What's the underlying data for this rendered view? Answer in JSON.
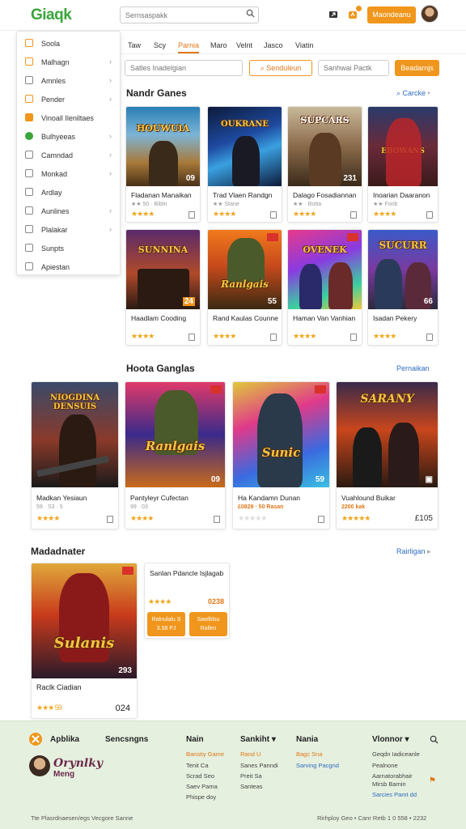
{
  "header": {
    "logo": "Giaqk",
    "search_placeholder": "Sernsaspakk",
    "primary_button": "Maondeanu"
  },
  "sidebar": {
    "items": [
      {
        "label": "Soola",
        "icon": "square-outline-icon",
        "color": "#f0961c",
        "chevron": false
      },
      {
        "label": "Malhagn",
        "icon": "edit-icon",
        "color": "#f0961c",
        "chevron": true
      },
      {
        "label": "Amnles",
        "icon": "list-icon",
        "color": "#888888",
        "chevron": true
      },
      {
        "label": "Pender",
        "icon": "window-icon",
        "color": "#f0961c",
        "chevron": true
      },
      {
        "label": "Vinoall Ileniltaes",
        "icon": "grid-icon",
        "color": "#f0961c",
        "chevron": false
      },
      {
        "label": "Bulhyeeas",
        "icon": "chat-bubble-icon",
        "color": "#3aa53a",
        "chevron": true
      },
      {
        "label": "Camndad",
        "icon": "folder-icon",
        "color": "#888888",
        "chevron": true
      },
      {
        "label": "Monkad",
        "icon": "box-icon",
        "color": "#888888",
        "chevron": true
      },
      {
        "label": "Ardlay",
        "icon": "document-icon",
        "color": "#888888",
        "chevron": false
      },
      {
        "label": "Aunlines",
        "icon": "user-icon",
        "color": "#888888",
        "chevron": true
      },
      {
        "label": "Plalakar",
        "icon": "bookmark-icon",
        "color": "#888888",
        "chevron": true
      },
      {
        "label": "Sunpts",
        "icon": "search-icon",
        "color": "#888888",
        "chevron": false
      },
      {
        "label": "Apiestan",
        "icon": "pencil-icon",
        "color": "#888888",
        "chevron": false
      }
    ]
  },
  "tabs": [
    "Taw",
    "Scy",
    "Parnia",
    "Maro",
    "Velnt",
    "Jasco",
    "Viatin"
  ],
  "active_tab": "Parnia",
  "filters": {
    "input1_placeholder": "Satles Inadelgian",
    "outline_button": "Senduleun",
    "input2_placeholder": "Sanhwai Pactk",
    "action_button": "Beadarnjs"
  },
  "sections": {
    "s1": {
      "title": "Nandr Ganes",
      "link": "Carcke"
    },
    "s2": {
      "title": "Hoota Ganglas",
      "link": "Pernaikan"
    },
    "s3": {
      "title": "Madadnater",
      "link": "Rairligan"
    }
  },
  "cards_row1": [
    {
      "art": "HOUWUIA",
      "num": "09",
      "title": "Fladanan Manaikan",
      "meta": "★★ 50 · Bibtn",
      "stars": "★★★★"
    },
    {
      "art": "OUKRANE",
      "num": "",
      "title": "Trad Vlaen Randgn",
      "meta": "★★ Stane",
      "stars": "★★★★"
    },
    {
      "art": "SUPCARS",
      "num": "231",
      "title": "Dalago Fosadiannan",
      "meta": "★★ · Botta",
      "stars": "★★★★"
    },
    {
      "art": "EBOWANS",
      "num": "",
      "title": "Inoarian Daaranon",
      "meta": "★★ Fonb",
      "stars": "★★★★"
    }
  ],
  "cards_row2": [
    {
      "art": "SUNNINA",
      "num": "24",
      "title": "Haadlam Cooding",
      "meta": "",
      "stars": "★★★★"
    },
    {
      "art": "Ranlgais",
      "num": "55",
      "title": "Rand Kaulas Counne",
      "meta": "",
      "stars": "★★★★"
    },
    {
      "art": "OVENEK",
      "num": "",
      "title": "Haman Van Vanhian",
      "meta": "",
      "stars": "★★★★"
    },
    {
      "art": "SUCURR",
      "num": "66",
      "title": "Isadan Pekery",
      "meta": "",
      "stars": "★★★★"
    }
  ],
  "cards_row3": [
    {
      "art": "NIOGDINA DENSUIS",
      "num": "",
      "title": "Madkan Yesiaun",
      "meta": "59 · S3 · 5",
      "stars": "★★★★",
      "price": ""
    },
    {
      "art": "Ranlgais",
      "num": "09",
      "title": "Pantyleyr Cufectan",
      "meta": "99 · 03",
      "stars": "★★★★",
      "price": ""
    },
    {
      "art": "Sunic",
      "num": "59",
      "title": "Ha Kandamn Dunan",
      "meta": "",
      "stars": "★★★★★",
      "price": "£0828 · 50 Rasan"
    },
    {
      "art": "SARANY",
      "num": "",
      "title": "Vuahlound Buikar",
      "meta": "",
      "stars": "★★★★★",
      "price": "2200 kak",
      "extra": "£105"
    }
  ],
  "feature_card": {
    "art": "Sulanis",
    "num": "293",
    "title": "Raclk Ciadian",
    "stars": "★★★ 59",
    "price": "024"
  },
  "promo": {
    "title": "Sanlan Pdancle Isjlagab",
    "stars": "★★★★",
    "price": "0238",
    "btn1": "Ralnulalu S 3.58 PJ",
    "btn2": "Sawlblsu Rallen"
  },
  "footer": {
    "brand_line1": "Apblika",
    "brand_name": "Orynlky",
    "brand_sub": "Meng",
    "columns": [
      {
        "head": "Sencsngns",
        "links": []
      },
      {
        "head": "Nain",
        "links": [
          "Banstiy Game",
          "Tenit Ca",
          "Scrad Seo",
          "Saev Pama",
          "Phispe doy"
        ]
      },
      {
        "head": "Sankiht",
        "links": [
          "Rand U",
          "Sanes Panndi",
          "Preit Sa",
          "Santeas"
        ]
      },
      {
        "head": "Nania",
        "links": [
          "Bagc Sna",
          "Sarving Pacgnd"
        ]
      },
      {
        "head": "Vlonnor",
        "links": [
          "Geqdn Iadiceanle",
          "Pealnone",
          "Aarnatorabhair",
          "Mirsb Bamin",
          "Sarcies Pamt dd"
        ]
      }
    ],
    "copyright": "Tte Plasrdnaesen/egs Vecgore Sanne",
    "copyright_right": "Rirhploy Geo • Canr Retb 1 0 558 • 2232"
  },
  "colors": {
    "accent": "#f0961c",
    "brand": "#3aa53a",
    "link": "#2d6cc0",
    "footer_bg": "#e6f0df"
  }
}
